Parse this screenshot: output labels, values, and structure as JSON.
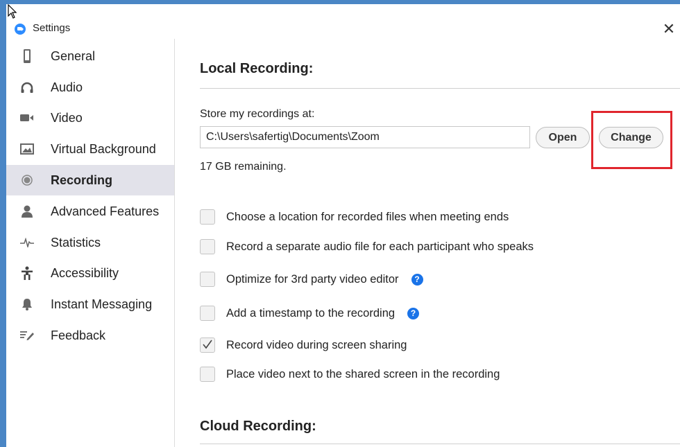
{
  "window": {
    "title": "Settings",
    "close_glyph": "✕"
  },
  "sidebar": {
    "items": [
      {
        "label": "General",
        "icon": "phone-icon"
      },
      {
        "label": "Audio",
        "icon": "headphones-icon"
      },
      {
        "label": "Video",
        "icon": "video-camera-icon"
      },
      {
        "label": "Virtual Background",
        "icon": "picture-icon"
      },
      {
        "label": "Recording",
        "icon": "record-icon",
        "active": true
      },
      {
        "label": "Advanced Features",
        "icon": "user-icon"
      },
      {
        "label": "Statistics",
        "icon": "pulse-icon"
      },
      {
        "label": "Accessibility",
        "icon": "accessibility-icon"
      },
      {
        "label": "Instant Messaging",
        "icon": "bell-icon"
      },
      {
        "label": "Feedback",
        "icon": "feedback-icon"
      }
    ]
  },
  "local_recording": {
    "title": "Local Recording:",
    "store_label": "Store my recordings at:",
    "path": "C:\\Users\\safertig\\Documents\\Zoom",
    "open_label": "Open",
    "change_label": "Change",
    "remaining": "17 GB remaining.",
    "highlight_color": "#e0262d",
    "options": [
      {
        "label": "Choose a location for recorded files when meeting ends",
        "checked": false,
        "help": false
      },
      {
        "label": "Record a separate audio file for each participant who speaks",
        "checked": false,
        "help": false
      },
      {
        "label": "Optimize for 3rd party video editor",
        "checked": false,
        "help": true
      },
      {
        "label": "Add a timestamp to the recording",
        "checked": false,
        "help": true
      },
      {
        "label": "Record video during screen sharing",
        "checked": true,
        "help": false
      },
      {
        "label": "Place video next to the shared screen in the recording",
        "checked": false,
        "help": false
      }
    ]
  },
  "cloud_recording": {
    "title": "Cloud Recording:"
  },
  "colors": {
    "accent": "#2d8cff",
    "frame": "#4a86c5",
    "active_bg": "#e2e2ea",
    "help": "#1a73e8"
  }
}
